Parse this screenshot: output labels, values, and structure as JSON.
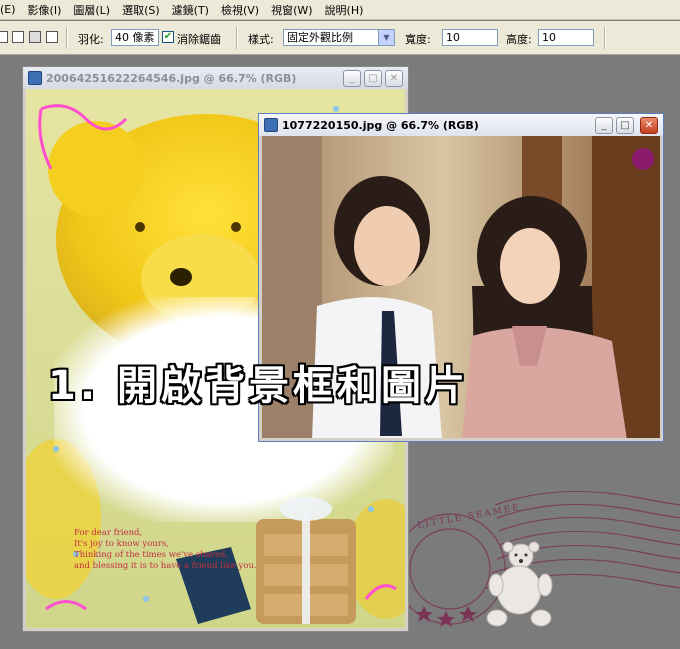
{
  "menu": [
    "(E)",
    "影像(I)",
    "圖層(L)",
    "選取(S)",
    "濾鏡(T)",
    "檢視(V)",
    "視窗(W)",
    "說明(H)"
  ],
  "options": {
    "feather_label": "羽化:",
    "feather_value": "40 像素",
    "antialias_label": "消除鋸齒",
    "antialias_checked": true,
    "style_label": "樣式:",
    "style_value": "固定外觀比例",
    "width_label": "寬度:",
    "width_value": "10",
    "height_label": "高度:",
    "height_value": "10"
  },
  "windows": {
    "background": {
      "title": "20064251622264546.jpg @ 66.7% (RGB)",
      "card_text": [
        "For dear friend,",
        "It's joy to know yours,",
        "Thinking of the times we've shared,",
        "and blessing it is to have a friend like you."
      ]
    },
    "photo": {
      "title": "1077220150.jpg @ 66.7% (RGB)"
    }
  },
  "overlay_caption": "1. 開啟背景框和圖片",
  "stamp_text": "LITTLE SEAMEE",
  "colors": {
    "workspace": "#7b7b7b",
    "toolbar": "#ece9d8",
    "close_button": "#c3401f"
  }
}
